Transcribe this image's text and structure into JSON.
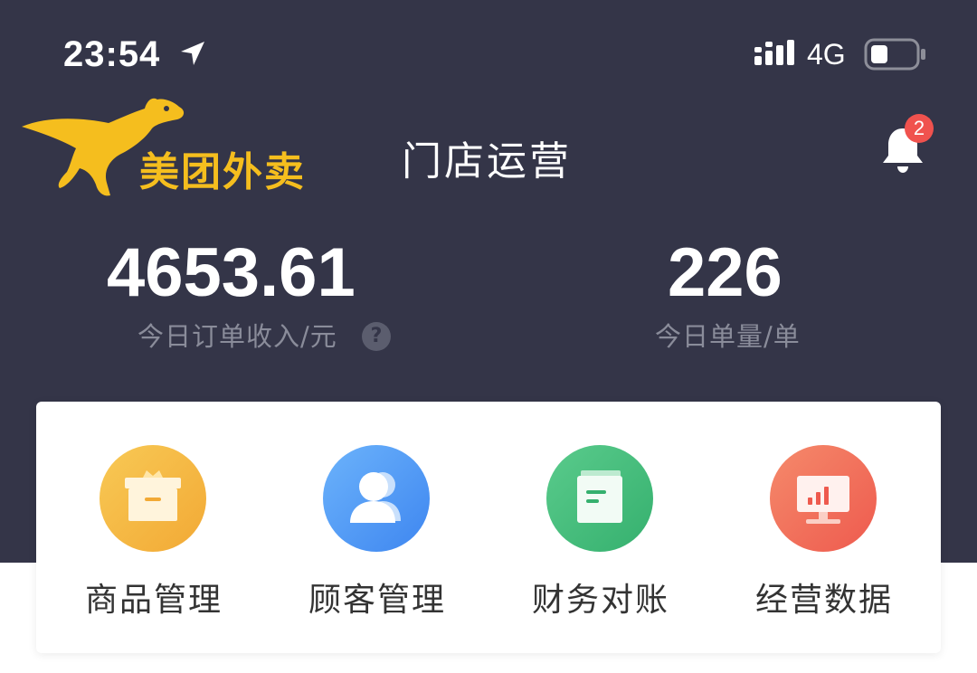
{
  "status_bar": {
    "time": "23:54",
    "network": "4G"
  },
  "header": {
    "logo_text": "美团外卖",
    "title": "门店运营",
    "notification_count": "2"
  },
  "stats": {
    "income_value": "4653.61",
    "income_label": "今日订单收入/元",
    "help_icon": "?",
    "orders_value": "226",
    "orders_label": "今日单量/单"
  },
  "menu": [
    {
      "label": "商品管理",
      "icon": "box-icon",
      "color": "#F5B83C"
    },
    {
      "label": "顾客管理",
      "icon": "user-icon",
      "color": "#4C9BF7"
    },
    {
      "label": "财务对账",
      "icon": "document-icon",
      "color": "#45C07D"
    },
    {
      "label": "经营数据",
      "icon": "chart-monitor-icon",
      "color": "#F06758"
    }
  ],
  "colors": {
    "header_bg": "#343548",
    "brand_yellow": "#F5BE1E",
    "badge_red": "#F0524E"
  }
}
